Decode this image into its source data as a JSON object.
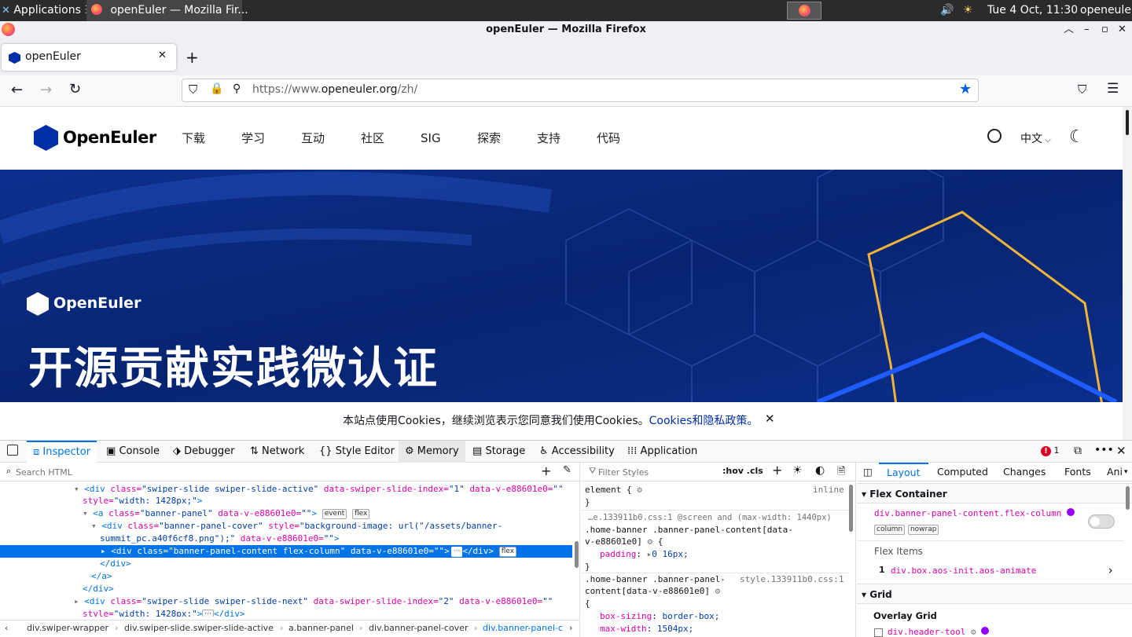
{
  "taskbar": {
    "apps_label": "Applications",
    "window_label": "openEuler — Mozilla Fir...",
    "datetime": "Tue  4 Oct, 11:30",
    "user": "openeuler"
  },
  "window": {
    "title": "openEuler — Mozilla Firefox"
  },
  "tabs": [
    {
      "label": "openEuler"
    }
  ],
  "urlbar": {
    "prefix": "https://www.",
    "domain": "openeuler.org",
    "path": "/zh/"
  },
  "site": {
    "logo_text": "OpenEuler",
    "nav": [
      "下载",
      "学习",
      "互动",
      "社区",
      "SIG",
      "探索",
      "支持",
      "代码"
    ],
    "lang": "中文",
    "banner": {
      "logo_text": "OpenEuler",
      "title": "开源贡献实践微认证"
    },
    "cookie": {
      "text": "本站点使用Cookies，继续浏览表示您同意我们使用Cookies。",
      "link": "Cookies和隐私政策。"
    }
  },
  "devtools": {
    "tabs": [
      "Inspector",
      "Console",
      "Debugger",
      "Network",
      "Style Editor",
      "Memory",
      "Storage",
      "Accessibility",
      "Application"
    ],
    "error_count": "1",
    "search_placeholder": "Search HTML",
    "filter_placeholder": "Filter Styles",
    "hov_cls": ":hov .cls",
    "layout_tabs": [
      "Layout",
      "Computed",
      "Changes",
      "Fonts",
      "Ani"
    ],
    "markup": {
      "l1a": "<div ",
      "l1b": "class=",
      "l1c": "\"swiper-slide swiper-slide-active\"",
      "l1d": " data-swiper-slide-index=",
      "l1e": "\"1\"",
      "l1f": " data-v-e88601e0=",
      "l1g": "\"\"",
      "l2a": "style=",
      "l2b": "\"width: 1428px;\"",
      "l2c": ">",
      "l3a": "<a ",
      "l3b": "class=",
      "l3c": "\"banner-panel\"",
      "l3d": " data-v-e88601e0=",
      "l3e": "\"\"",
      "l3f": ">",
      "badge_event": "event",
      "badge_flex": "flex",
      "l4a": "<div ",
      "l4b": "class=",
      "l4c": "\"banner-panel-cover\"",
      "l4d": " style=",
      "l4e": "\"background-image: url(\"/assets/banner-",
      "l5a": "summit_pc.a40f6cf8.png\");\"",
      "l5b": " data-v-e88601e0=",
      "l5c": "\"\"",
      "l5d": ">",
      "l6": "<div class=\"banner-panel-content flex-column\" data-v-e88601e0=\"\">",
      "l6end": "</div>",
      "l7": "</div>",
      "l8": "</a>",
      "l9": "</div>",
      "l10a": "<div ",
      "l10b": "class=",
      "l10c": "\"swiper-slide swiper-slide-next\"",
      "l10d": " data-swiper-slide-index=",
      "l10e": "\"2\"",
      "l10f": " data-v-e88601e0=",
      "l10g": "\"\"",
      "l11a": "style=",
      "l11b": "\"width: 1428px;\"",
      "l11c": ">",
      "l11d": "</div>"
    },
    "breadcrumbs": [
      "div.swiper-wrapper",
      "div.swiper-slide.swiper-slide-active",
      "a.banner-panel",
      "div.banner-panel-cover",
      "div.banner-panel-c"
    ],
    "rules": {
      "r1_sel": "element {",
      "r1_src": "inline",
      "r1_end": "}",
      "r2_media": "…e.133911b0.css:1 @screen and (max-width: 1440px)",
      "r2_sel1": ".home-banner .banner-panel-content[data-",
      "r2_sel2": "v-e88601e0]",
      "r2_prop": "padding",
      "r2_val": "0 16px;",
      "r2_end": "}",
      "r3_sel1": ".home-banner .banner-panel-",
      "r3_src": "style.133911b0.css:1",
      "r3_sel2": "content[data-v-e88601e0]",
      "r3_open": "{",
      "r3_p1": "box-sizing",
      "r3_v1": "border-box;",
      "r3_p2": "max-width",
      "r3_v2": "1504px;"
    },
    "layout": {
      "flex_container": "Flex Container",
      "flex_selector": "div.banner-panel-content.flex-column",
      "badge_column": "column",
      "badge_nowrap": "nowrap",
      "flex_items": "Flex Items",
      "item_index": "1",
      "item_selector": "div.box.aos-init.aos-animate",
      "grid": "Grid",
      "overlay_grid": "Overlay Grid",
      "grid_item": "div.header-tool"
    }
  }
}
